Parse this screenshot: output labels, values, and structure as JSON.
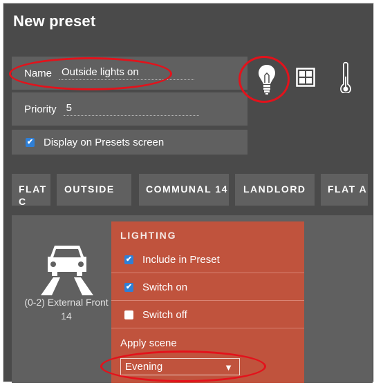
{
  "header": {
    "title": "New preset"
  },
  "form": {
    "name_label": "Name",
    "name_value": "Outside lights on",
    "priority_label": "Priority",
    "priority_value": "5",
    "display_label": "Display on Presets screen",
    "display_checked": true
  },
  "type_icons": [
    "lightbulb-icon",
    "window-icon",
    "thermometer-icon"
  ],
  "tabs": [
    {
      "label": "FLAT C"
    },
    {
      "label": "OUTSIDE"
    },
    {
      "label": "COMMUNAL 14"
    },
    {
      "label": "LANDLORD"
    },
    {
      "label": "FLAT A"
    }
  ],
  "device": {
    "icon": "car-icon",
    "name": "(0-2) External Front 14"
  },
  "lighting": {
    "heading": "LIGHTING",
    "options": [
      {
        "label": "Include in Preset",
        "checked": true
      },
      {
        "label": "Switch on",
        "checked": true
      },
      {
        "label": "Switch off",
        "checked": false
      }
    ],
    "apply_scene_label": "Apply scene",
    "scene_value": "Evening",
    "dropdown_arrow": "▼"
  },
  "colors": {
    "panel_bg": "#4a4a4a",
    "field_bg": "#606060",
    "lighting_bg": "#c0533d",
    "checkbox_on": "#2f7fd6",
    "annotation_red": "#e3121b"
  }
}
